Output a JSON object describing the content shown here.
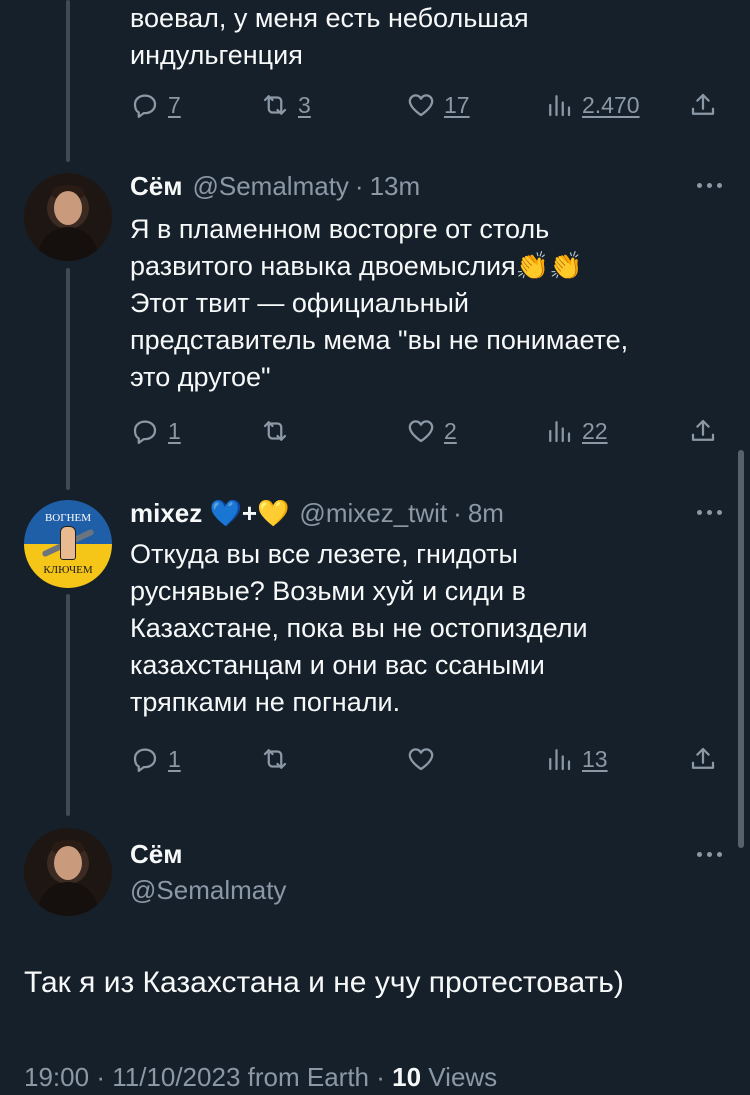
{
  "top_tweet": {
    "text_line1": "воевал, у меня есть небольшая",
    "text_line2": "индульгенция",
    "replies": "7",
    "retweets": "3",
    "likes": "17",
    "views": "2.470"
  },
  "tweet2": {
    "name": "Сём",
    "handle": "@Semalmaty",
    "time": "13m",
    "lines": [
      "Я в пламенном восторге от столь",
      "развитого навыка двоемыслия👏👏",
      "Этот твит — официальный",
      "представитель мема \"вы не понимаете,",
      "это другое\""
    ],
    "replies": "1",
    "retweets": "",
    "likes": "2",
    "views": "22"
  },
  "tweet3": {
    "name": "mixez 💙+💛",
    "handle": "@mixez_twit",
    "time": "8m",
    "avatar_text_top": "ВОГНЕМ",
    "avatar_text_bottom": "КЛЮЧЕМ",
    "lines": [
      "Откуда вы все лезете, гнидоты",
      "руснявые? Возьми хуй и сиди в",
      "Казахстане, пока вы не остопиздели",
      "казахстанцам и они вас ссаными",
      "тряпками не погнали."
    ],
    "replies": "1",
    "retweets": "",
    "likes": "",
    "views": "13"
  },
  "main_tweet": {
    "name": "Сём",
    "handle": "@Semalmaty",
    "text": "Так я из Казахстана и не учу протестовать)",
    "time": "19:00",
    "date": "11/10/2023",
    "source": "from Earth",
    "views_count": "10",
    "views_label": "Views"
  },
  "icons": [
    "reply-icon",
    "retweet-icon",
    "like-icon",
    "views-icon",
    "share-icon",
    "more-icon"
  ],
  "colors": {
    "background": "#15202b",
    "text": "#f7f9f9",
    "muted": "#8b98a5",
    "thread_line": "#3f4a55"
  }
}
